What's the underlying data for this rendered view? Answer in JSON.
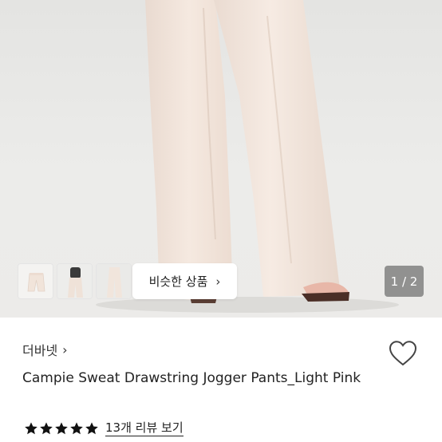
{
  "gallery": {
    "similar_label": "비슷한 상품",
    "chevron": "›",
    "pager": "1 / 2",
    "thumbnails": [
      "thumbnail-1",
      "thumbnail-2",
      "thumbnail-3"
    ]
  },
  "product": {
    "brand": "더바넷",
    "brand_chevron": "›",
    "title": "Campie Sweat Drawstring Jogger Pants_Light Pink",
    "review_link": "13개 리뷰 보기",
    "rating": 5,
    "rating_max": 5
  },
  "icons": {
    "wishlist": "heart-outline-icon",
    "star": "star-icon"
  },
  "colors": {
    "pants": "#f3e6dc",
    "background": "#e6e6e4",
    "pager_bg": "#6e6e6e"
  }
}
